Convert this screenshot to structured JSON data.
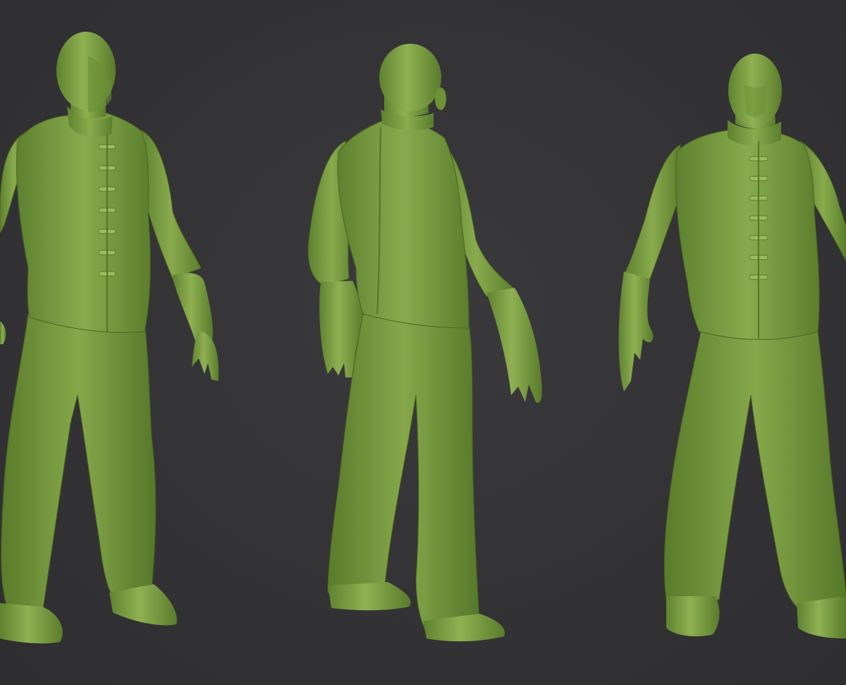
{
  "scene": {
    "background_color": "#333335",
    "material_color": "#7fa046",
    "material_highlight": "#a9c86a",
    "material_shadow": "#4c6a22"
  },
  "figures": [
    {
      "view": "front-three-quarter"
    },
    {
      "view": "back-three-quarter"
    },
    {
      "view": "front"
    }
  ]
}
